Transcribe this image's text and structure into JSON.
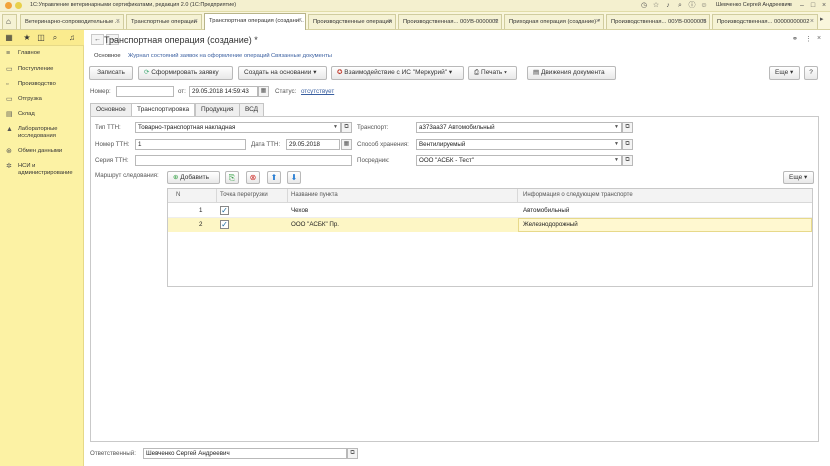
{
  "app": {
    "title": "1С:Управление ветеринарными сертификатами, редакция 2.0  (1С:Предприятие)",
    "user": "Шевченко Сергей Андреевич"
  },
  "tabs": [
    "Ветеринарно-сопроводительные ...",
    "Транспортные операции",
    "Транспортная операция (создани...",
    "Производственные операции",
    "Производственная... 00УВ-0000002",
    "Приходная операция (создание) *",
    "Производственная... 00УВ-0000003",
    "Производственная... 00000000002"
  ],
  "sidebar": {
    "items": [
      "Главное",
      "Поступление",
      "Производство",
      "Отгрузка",
      "Склад",
      "Лабораторные исследования",
      "Обмен данными",
      "НСИ и администрирование"
    ]
  },
  "form": {
    "title": "Транспортная операция (создание) *",
    "links": {
      "main": "Основное",
      "journal": "Журнал состояний заявок на оформление операций",
      "related": "Связанные документы"
    },
    "toolbar": {
      "record": "Записать",
      "form_request": "Сформировать заявку",
      "create_base": "Создать на основании",
      "interaction": "Взаимодействие с ИС \"Меркурий\"",
      "print": "Печать",
      "movements": "Движения документа",
      "more": "Еще"
    },
    "number_label": "Номер:",
    "number_value": "",
    "date_label": "от:",
    "date_value": "29.05.2018 14:59:43",
    "status_label": "Статус:",
    "status_value": "отсутствует",
    "tabs": [
      "Основное",
      "Транспортировка",
      "Продукция",
      "ВСД"
    ],
    "fields": {
      "ttn_type_label": "Тип ТТН:",
      "ttn_type_value": "Товарно-транспортная накладная",
      "ttn_number_label": "Номер ТТН:",
      "ttn_number_value": "1",
      "ttn_date_label": "Дата ТТН:",
      "ttn_date_value": "29.05.2018",
      "ttn_series_label": "Серия ТТН:",
      "ttn_series_value": "",
      "transport_label": "Транспорт:",
      "transport_value": "а373аа37  Автомобильный",
      "storage_label": "Способ хранения:",
      "storage_value": "Вентилируемый",
      "agent_label": "Посредник:",
      "agent_value": "ООО \"АСБК - Тест\""
    },
    "route": {
      "label": "Маршрут следования:",
      "add": "Добавить",
      "more": "Еще",
      "columns": [
        "N",
        "Точка перегрузки",
        "Название пункта",
        "Информация о следующем транспорте"
      ],
      "rows": [
        {
          "n": "1",
          "transfer": true,
          "name": "Чехов",
          "info": "Автомобильный"
        },
        {
          "n": "2",
          "transfer": true,
          "name": "ООО \"АСБК\" Пр.",
          "info": "Железнодорожный"
        }
      ]
    },
    "responsible_label": "Ответственный:",
    "responsible_value": "Шевченко Сергей Андреевич"
  },
  "colors": {
    "sidebar": "#fcf2a4",
    "accent_link": "#3a5fa0",
    "selected_row": "#fdf6c5"
  }
}
